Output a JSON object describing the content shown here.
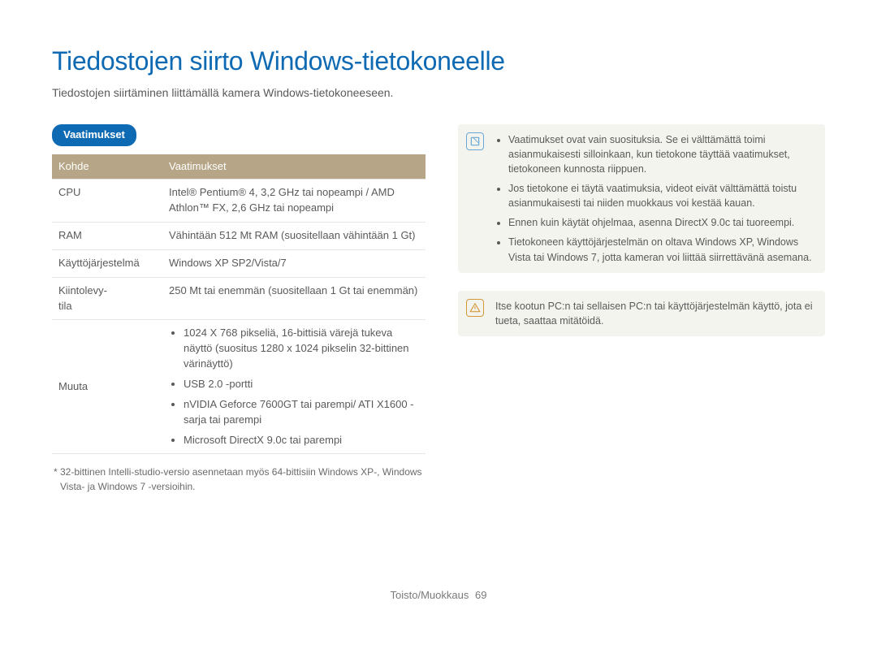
{
  "title": "Tiedostojen siirto Windows-tietokoneelle",
  "subtitle": "Tiedostojen siirtäminen liittämällä kamera Windows-tietokoneeseen.",
  "section_label": "Vaatimukset",
  "table": {
    "headers": {
      "col1": "Kohde",
      "col2": "Vaatimukset"
    },
    "rows": {
      "cpu": {
        "label": "CPU",
        "value": "Intel® Pentium® 4, 3,2 GHz tai nopeampi / AMD Athlon™ FX, 2,6 GHz tai nopeampi"
      },
      "ram": {
        "label": "RAM",
        "value": "Vähintään 512 Mt RAM (suositellaan vähintään 1 Gt)"
      },
      "os": {
        "label": "Käyttöjärjestelmä",
        "value": "Windows XP SP2/Vista/7"
      },
      "hdd": {
        "label": "Kiintolevy-\ntila",
        "value": "250 Mt tai enemmän (suositellaan 1 Gt tai enemmän)"
      },
      "other": {
        "label": "Muuta",
        "items": [
          "1024 X 768 pikseliä, 16-bittisiä värejä tukeva näyttö (suositus 1280 x 1024 pikselin 32-bittinen värinäyttö)",
          "USB 2.0 -portti",
          "nVIDIA Geforce 7600GT tai parempi/ ATI X1600 -sarja tai parempi",
          "Microsoft DirectX 9.0c tai parempi"
        ]
      }
    }
  },
  "footnote": "* 32-bittinen Intelli-studio-versio asennetaan myös 64-bittisiin Windows XP-, Windows Vista- ja Windows 7 -versioihin.",
  "note_items": [
    "Vaatimukset ovat vain suosituksia. Se ei välttämättä toimi asianmukaisesti silloinkaan, kun tietokone täyttää vaatimukset, tietokoneen kunnosta riippuen.",
    "Jos tietokone ei täytä vaatimuksia, videot eivät välttämättä toistu asianmukaisesti tai niiden muokkaus voi kestää kauan.",
    "Ennen kuin käytät ohjelmaa, asenna DirectX 9.0c tai tuoreempi.",
    "Tietokoneen käyttöjärjestelmän on oltava Windows XP, Windows Vista tai Windows 7, jotta kameran voi liittää siirrettävänä asemana."
  ],
  "warning_text": "Itse kootun PC:n tai sellaisen PC:n tai käyttöjärjestelmän käyttö, jota ei tueta, saattaa mitätöidä.",
  "footer": {
    "section": "Toisto/Muokkaus",
    "page": "69"
  }
}
